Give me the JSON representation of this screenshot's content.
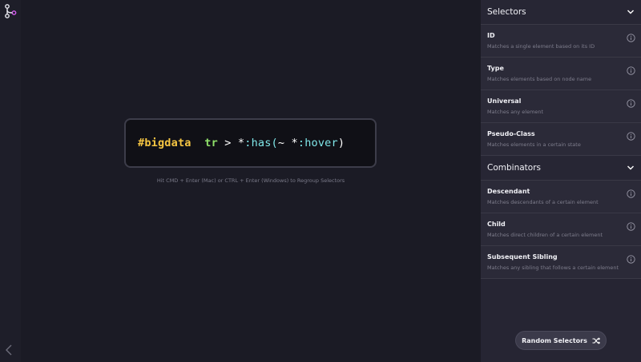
{
  "editor": {
    "tokens": [
      {
        "text": "#bigdata",
        "kind": "id"
      },
      {
        "text": "  ",
        "kind": "op"
      },
      {
        "text": "tr",
        "kind": "type"
      },
      {
        "text": " > ",
        "kind": "op"
      },
      {
        "text": "*",
        "kind": "op"
      },
      {
        "text": ":has(",
        "kind": "pseudo"
      },
      {
        "text": "~ ",
        "kind": "op"
      },
      {
        "text": "*",
        "kind": "op"
      },
      {
        "text": ":hover",
        "kind": "pseudo"
      },
      {
        "text": ")",
        "kind": "op"
      }
    ],
    "hint": "Hit CMD + Enter (Mac) or CTRL + Enter (Windows) to Regroup Selectors"
  },
  "sidebar": {
    "selectors": {
      "title": "Selectors",
      "items": [
        {
          "title": "ID",
          "desc": "Matches a single element based on its ID"
        },
        {
          "title": "Type",
          "desc": "Matches elements based on node name"
        },
        {
          "title": "Universal",
          "desc": "Matches any element"
        },
        {
          "title": "Pseudo-Class",
          "desc": "Matches elements in a certain state"
        }
      ]
    },
    "combinators": {
      "title": "Combinators",
      "items": [
        {
          "title": "Descendant",
          "desc": "Matches descendants of a certain element"
        },
        {
          "title": "Child",
          "desc": "Matches direct children of a certain element"
        },
        {
          "title": "Subsequent Sibling",
          "desc": "Matches any sibling that follows a certain element"
        }
      ]
    },
    "random_button": "Random Selectors"
  },
  "icons": {
    "logo": "branch-logo-icon",
    "back": "chevron-left-icon",
    "collapse": "chevron-down-icon",
    "info": "info-icon",
    "shuffle": "shuffle-icon"
  },
  "colors": {
    "id_token": "#f5c542",
    "type_token": "#8fe06a",
    "pseudo_token": "#7fe6e8",
    "background": "#1b1b25",
    "sidebar": "#262533"
  }
}
